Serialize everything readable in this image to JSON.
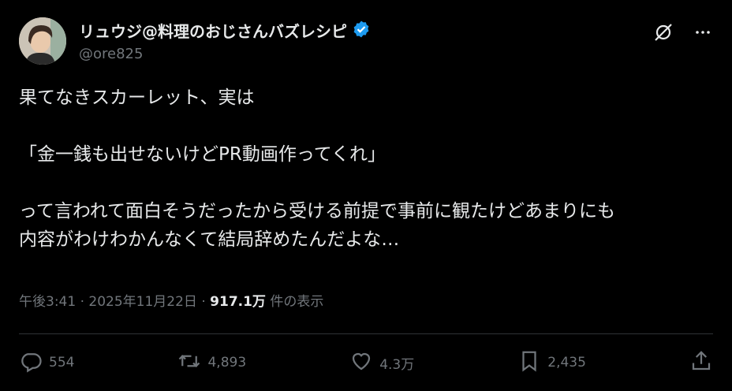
{
  "user": {
    "display_name": "リュウジ@料理のおじさんバズレシピ",
    "handle": "@ore825"
  },
  "tweet": {
    "text": "果てなきスカーレット、実は\n\n「金一銭も出せないけどPR動画作ってくれ」\n\nって言われて面白そうだったから受ける前提で事前に観たけどあまりにも\n内容がわけわかんなくて結局辞めたんだよな…"
  },
  "meta": {
    "time": "午後3:41",
    "separator": "·",
    "date": "2025年11月22日",
    "views": "917.1万",
    "views_label": "件の表示"
  },
  "actions": {
    "replies": "554",
    "reposts": "4,893",
    "likes": "4.3万",
    "bookmarks": "2,435"
  },
  "colors": {
    "background": "#000000",
    "text": "#e7e9ea",
    "muted": "#71767b",
    "verified": "#1d9bf0",
    "divider": "#2f3336"
  },
  "icons": [
    "verified-badge-icon",
    "grok-icon",
    "more-icon",
    "reply-icon",
    "repost-icon",
    "like-icon",
    "bookmark-icon",
    "share-icon"
  ]
}
